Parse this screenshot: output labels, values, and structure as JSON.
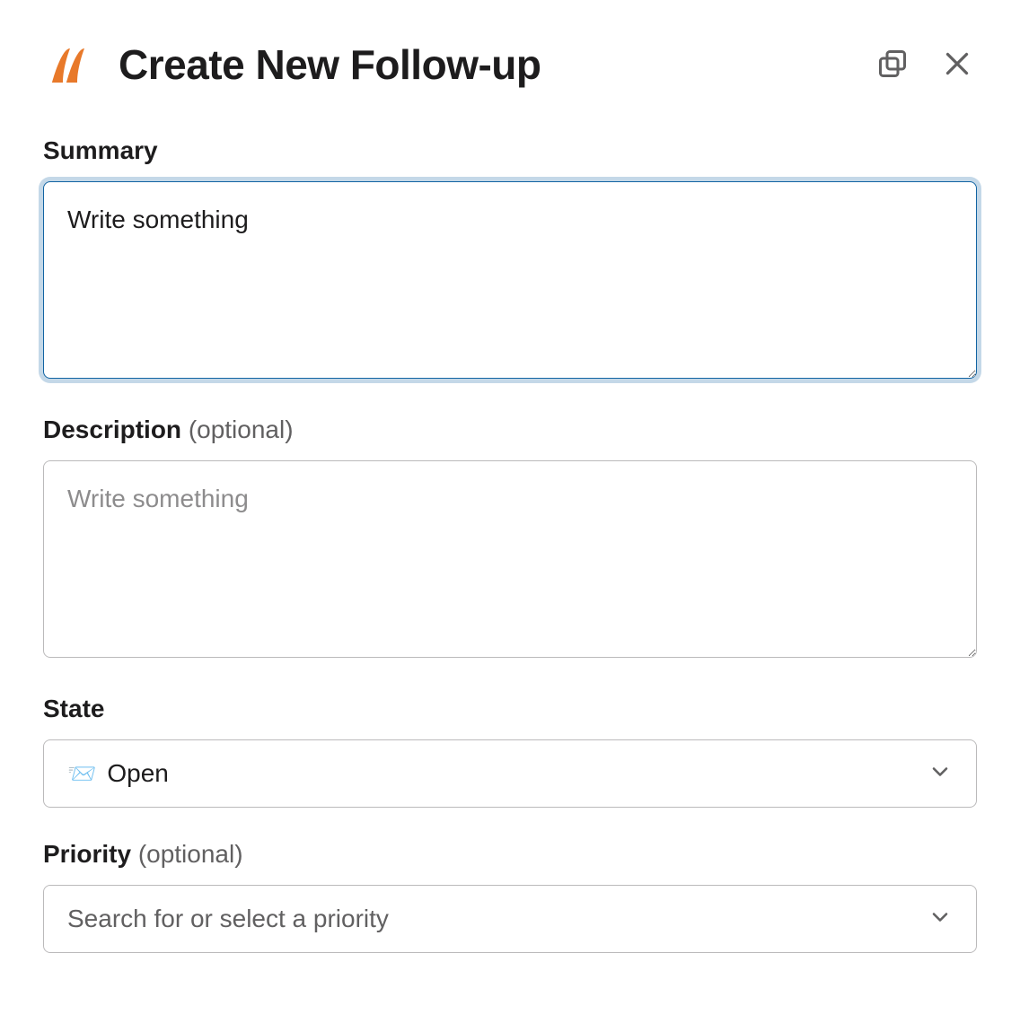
{
  "modal": {
    "title": "Create New Follow-up"
  },
  "form": {
    "summary": {
      "label": "Summary",
      "value": "Write something"
    },
    "description": {
      "label": "Description",
      "optional": "(optional)",
      "placeholder": "Write something"
    },
    "state": {
      "label": "State",
      "selected_icon": "📨",
      "selected_value": "Open"
    },
    "priority": {
      "label": "Priority",
      "optional": "(optional)",
      "placeholder": "Search for or select a priority"
    }
  }
}
